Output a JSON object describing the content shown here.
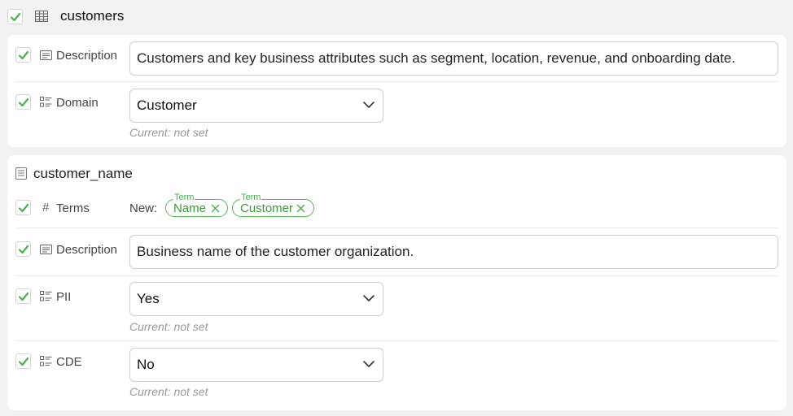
{
  "table": {
    "name": "customers",
    "description_label": "Description",
    "description_value": "Customers and key business attributes such as segment, location, revenue, and onboarding date.",
    "domain_label": "Domain",
    "domain_value": "Customer",
    "domain_current": "Current: not set"
  },
  "column": {
    "name": "customer_name",
    "terms_label": "Terms",
    "terms_prefix": "New:",
    "terms": [
      {
        "caption": "Term",
        "label": "Name"
      },
      {
        "caption": "Term",
        "label": "Customer"
      }
    ],
    "description_label": "Description",
    "description_value": "Business name of the customer organization.",
    "pii_label": "PII",
    "pii_value": "Yes",
    "pii_current": "Current: not set",
    "cde_label": "CDE",
    "cde_value": "No",
    "cde_current": "Current: not set"
  },
  "colors": {
    "check_green": "#4caf50",
    "tag_green": "#5cb85c"
  },
  "icons": {
    "checkbox": "check-icon",
    "table": "table-icon",
    "description": "description-icon",
    "select": "list-icon",
    "column": "column-icon",
    "terms": "hash-icon",
    "dropdown": "chevron-down-icon",
    "remove": "close-icon"
  }
}
